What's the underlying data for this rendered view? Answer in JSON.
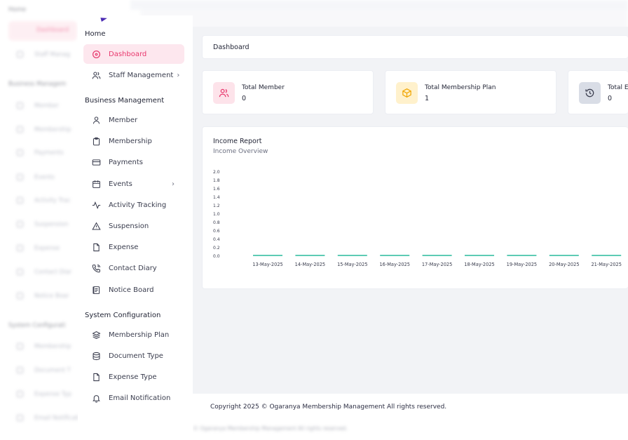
{
  "background_ghost": {
    "sidebar_sections": [
      "Home",
      "Business Managem",
      "System Configurati"
    ],
    "sidebar_items": [
      "Dashboard",
      "Staff Manag",
      "Member",
      "Membership",
      "Payments",
      "Events",
      "Activity Trac",
      "Suspension",
      "Expense",
      "Contact Diar",
      "Notice Boar",
      "Membership",
      "Document T",
      "Expense Typ",
      "Email Notification"
    ],
    "footer": "Copyright 2025 © Ogaranya Membership Management All rights reserved."
  },
  "sidebar": {
    "sections": {
      "home": "Home",
      "business": "Business Management",
      "system": "System Configuration"
    },
    "home_items": [
      {
        "label": "Dashboard",
        "icon": "dashboard-icon",
        "active": true
      },
      {
        "label": "Staff Management",
        "icon": "users-icon",
        "has_chevron": true
      }
    ],
    "business_items": [
      {
        "label": "Member",
        "icon": "user-icon"
      },
      {
        "label": "Membership",
        "icon": "clipboard-icon"
      },
      {
        "label": "Payments",
        "icon": "credit-card-icon"
      },
      {
        "label": "Events",
        "icon": "calendar-icon",
        "has_chevron": true
      },
      {
        "label": "Activity Tracking",
        "icon": "activity-icon"
      },
      {
        "label": "Suspension",
        "icon": "warning-icon"
      },
      {
        "label": "Expense",
        "icon": "file-icon"
      },
      {
        "label": "Contact Diary",
        "icon": "phone-icon"
      },
      {
        "label": "Notice Board",
        "icon": "notice-icon"
      }
    ],
    "system_items": [
      {
        "label": "Membership Plan",
        "icon": "layers-icon"
      },
      {
        "label": "Document Type",
        "icon": "database-icon"
      },
      {
        "label": "Expense Type",
        "icon": "file-icon"
      },
      {
        "label": "Email Notification",
        "icon": "bell-icon"
      }
    ],
    "chevron": "›"
  },
  "page": {
    "title": "Dashboard"
  },
  "stats": [
    {
      "label": "Total Member",
      "value": "0",
      "icon": "users-icon",
      "badge_color": "#fde3ea",
      "icon_color": "#e8386d"
    },
    {
      "label": "Total Membership Plan",
      "value": "1",
      "icon": "box-icon",
      "badge_color": "#fff1cc",
      "icon_color": "#f0a500"
    },
    {
      "label": "Total E",
      "value": "0",
      "icon": "history-icon",
      "badge_color": "#d9dde6",
      "icon_color": "#3a3d4e"
    }
  ],
  "income_report": {
    "title": "Income Report",
    "subtitle": "Income Overview"
  },
  "chart_data": {
    "type": "bar",
    "categories": [
      "13-May-2025",
      "14-May-2025",
      "15-May-2025",
      "16-May-2025",
      "17-May-2025",
      "18-May-2025",
      "19-May-2025",
      "20-May-2025",
      "21-May-2025"
    ],
    "series": [
      {
        "values": [
          0,
          0,
          0,
          0,
          0,
          0,
          0,
          0,
          0
        ]
      }
    ],
    "y_ticks": [
      "2.0",
      "1.8",
      "1.6",
      "1.4",
      "1.2",
      "1.0",
      "0.8",
      "0.6",
      "0.4",
      "0.2",
      "0.0"
    ],
    "ylim": [
      0,
      2
    ],
    "bar_color": "#5ecbb5",
    "grid": false
  },
  "footer": {
    "copyright": "Copyright 2025 © Ogaranya Membership Management All rights reserved."
  },
  "colors": {
    "accent": "#e8386d",
    "active_bg": "#fde7ee",
    "content_bg": "#f2f3f6"
  }
}
